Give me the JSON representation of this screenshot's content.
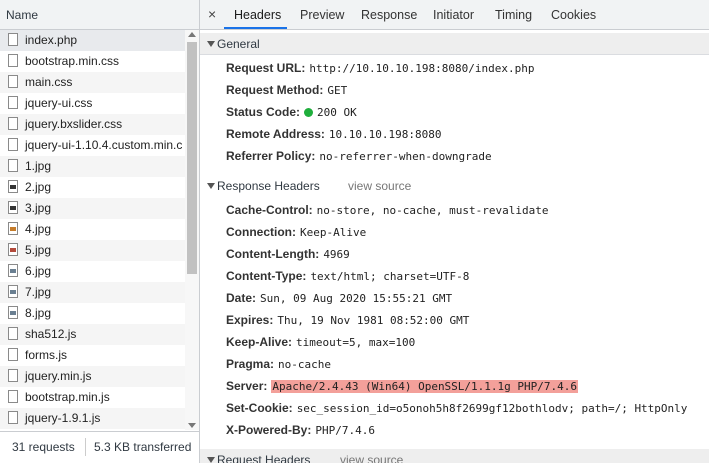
{
  "left_panel": {
    "header": "Name",
    "files": [
      {
        "name": "index.php",
        "icon": "document-icon"
      },
      {
        "name": "bootstrap.min.css",
        "icon": "document-icon"
      },
      {
        "name": "main.css",
        "icon": "document-icon"
      },
      {
        "name": "jquery-ui.css",
        "icon": "document-icon"
      },
      {
        "name": "jquery.bxslider.css",
        "icon": "document-icon"
      },
      {
        "name": "jquery-ui-1.10.4.custom.min.c",
        "icon": "document-icon"
      },
      {
        "name": "1.jpg",
        "icon": "image-icon"
      },
      {
        "name": "2.jpg",
        "icon": "image-icon"
      },
      {
        "name": "3.jpg",
        "icon": "image-icon"
      },
      {
        "name": "4.jpg",
        "icon": "image-icon"
      },
      {
        "name": "5.jpg",
        "icon": "image-icon"
      },
      {
        "name": "6.jpg",
        "icon": "image-icon"
      },
      {
        "name": "7.jpg",
        "icon": "image-icon"
      },
      {
        "name": "8.jpg",
        "icon": "image-icon"
      },
      {
        "name": "sha512.js",
        "icon": "document-icon"
      },
      {
        "name": "forms.js",
        "icon": "document-icon"
      },
      {
        "name": "jquery.min.js",
        "icon": "document-icon"
      },
      {
        "name": "bootstrap.min.js",
        "icon": "document-icon"
      },
      {
        "name": "jquery-1.9.1.js",
        "icon": "document-icon"
      }
    ],
    "status": {
      "requests": "31 requests",
      "transferred": "5.3 KB transferred"
    }
  },
  "tabs": {
    "close": "×",
    "items": [
      "Headers",
      "Preview",
      "Response",
      "Initiator",
      "Timing",
      "Cookies"
    ],
    "active": "Headers"
  },
  "general": {
    "title": "General",
    "request_url_label": "Request URL:",
    "request_url": "http://10.10.10.198:8080/index.php",
    "request_method_label": "Request Method:",
    "request_method": "GET",
    "status_code_label": "Status Code:",
    "status_code": "200 OK",
    "remote_address_label": "Remote Address:",
    "remote_address": "10.10.10.198:8080",
    "referrer_policy_label": "Referrer Policy:",
    "referrer_policy": "no-referrer-when-downgrade"
  },
  "response_headers": {
    "title": "Response Headers",
    "view_source": "view source",
    "items": [
      {
        "key": "Cache-Control:",
        "value": "no-store, no-cache, must-revalidate"
      },
      {
        "key": "Connection:",
        "value": "Keep-Alive"
      },
      {
        "key": "Content-Length:",
        "value": "4969"
      },
      {
        "key": "Content-Type:",
        "value": "text/html; charset=UTF-8"
      },
      {
        "key": "Date:",
        "value": "Sun, 09 Aug 2020 15:55:21 GMT"
      },
      {
        "key": "Expires:",
        "value": "Thu, 19 Nov 1981 08:52:00 GMT"
      },
      {
        "key": "Keep-Alive:",
        "value": "timeout=5, max=100"
      },
      {
        "key": "Pragma:",
        "value": "no-cache"
      },
      {
        "key": "Server:",
        "value": "Apache/2.4.43 (Win64) OpenSSL/1.1.1g PHP/7.4.6"
      },
      {
        "key": "Set-Cookie:",
        "value": "sec_session_id=o5onoh5h8f2699gf12bothlodv; path=/; HttpOnly"
      },
      {
        "key": "X-Powered-By:",
        "value": "PHP/7.4.6"
      }
    ]
  },
  "request_headers": {
    "title": "Request Headers",
    "view_source": "view source"
  },
  "colors": {
    "status_ok": "#1fae3c",
    "highlight": "#f3a09a",
    "tab_accent": "#1a73e8"
  }
}
